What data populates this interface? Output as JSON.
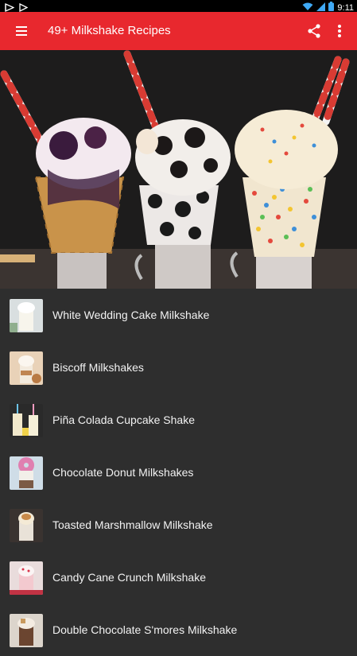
{
  "status_bar": {
    "time": "9:11"
  },
  "app_bar": {
    "title": "49+ Milkshake Recipes"
  },
  "colors": {
    "accent": "#e8282e",
    "list_background": "#2e2e2e"
  },
  "hero": {
    "icon": "milkshakes-photo"
  },
  "recipes": [
    {
      "label": "White Wedding Cake Milkshake",
      "icon": "white-milkshake-thumbnail"
    },
    {
      "label": "Biscoff Milkshakes",
      "icon": "biscoff-milkshake-thumbnail"
    },
    {
      "label": "Piña Colada Cupcake Shake",
      "icon": "pina-colada-shake-thumbnail"
    },
    {
      "label": "Chocolate Donut Milkshakes",
      "icon": "donut-milkshake-thumbnail"
    },
    {
      "label": "Toasted Marshmallow Milkshake",
      "icon": "marshmallow-milkshake-thumbnail"
    },
    {
      "label": "Candy Cane Crunch Milkshake",
      "icon": "candy-cane-milkshake-thumbnail"
    },
    {
      "label": "Double Chocolate S'mores Milkshake",
      "icon": "smores-milkshake-thumbnail"
    }
  ]
}
